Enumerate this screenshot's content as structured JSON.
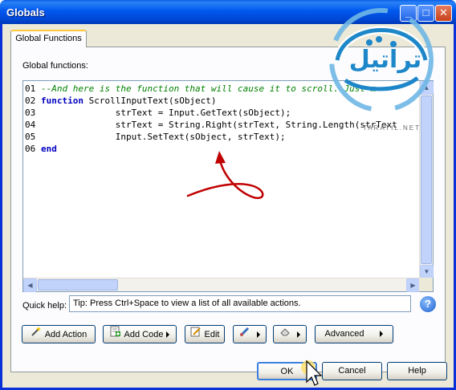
{
  "window": {
    "title": "Globals",
    "controls": [
      "minimize-icon",
      "maximize-icon",
      "close-icon"
    ]
  },
  "tab": {
    "label": "Global Functions"
  },
  "editor": {
    "label": "Global functions:",
    "lines": [
      {
        "num": "01",
        "parts": [
          {
            "cls": "cmt",
            "text": "--And here is the function that will cause it to scroll. Just m"
          }
        ]
      },
      {
        "num": "02",
        "parts": [
          {
            "cls": "kw",
            "text": "function"
          },
          {
            "cls": "txt",
            "text": " ScrollInputText(sObject)"
          }
        ]
      },
      {
        "num": "03",
        "parts": [
          {
            "cls": "txt",
            "text": "              strText = Input.GetText(sObject);"
          }
        ]
      },
      {
        "num": "04",
        "parts": [
          {
            "cls": "txt",
            "text": "              strText = String.Right(strText, String.Length(strText"
          }
        ]
      },
      {
        "num": "05",
        "parts": [
          {
            "cls": "txt",
            "text": "              Input.SetText(sObject, strText);"
          }
        ]
      },
      {
        "num": "06",
        "parts": [
          {
            "cls": "kw",
            "text": "end"
          }
        ]
      }
    ]
  },
  "quick_help": {
    "label": "Quick help:",
    "value": "Tip: Press Ctrl+Space to view a list of all available actions.",
    "help_icon": "help-question-icon"
  },
  "toolbar": {
    "add_action": "Add Action",
    "add_code": "Add Code",
    "edit": "Edit",
    "advanced": "Advanced",
    "icons": [
      "wand-icon",
      "code-plus-icon",
      "pencil-icon",
      "brush-icon",
      "eraser-icon"
    ]
  },
  "dialog_buttons": {
    "ok": "OK",
    "cancel": "Cancel",
    "help": "Help"
  },
  "watermark": {
    "text": "تراتيل",
    "subtext": "TARATIL.NET"
  },
  "colors": {
    "titlebar": "#0058ee",
    "client": "#ece9d8",
    "annotation": "#c00000",
    "comment": "#008000",
    "keyword": "#0000c0"
  }
}
